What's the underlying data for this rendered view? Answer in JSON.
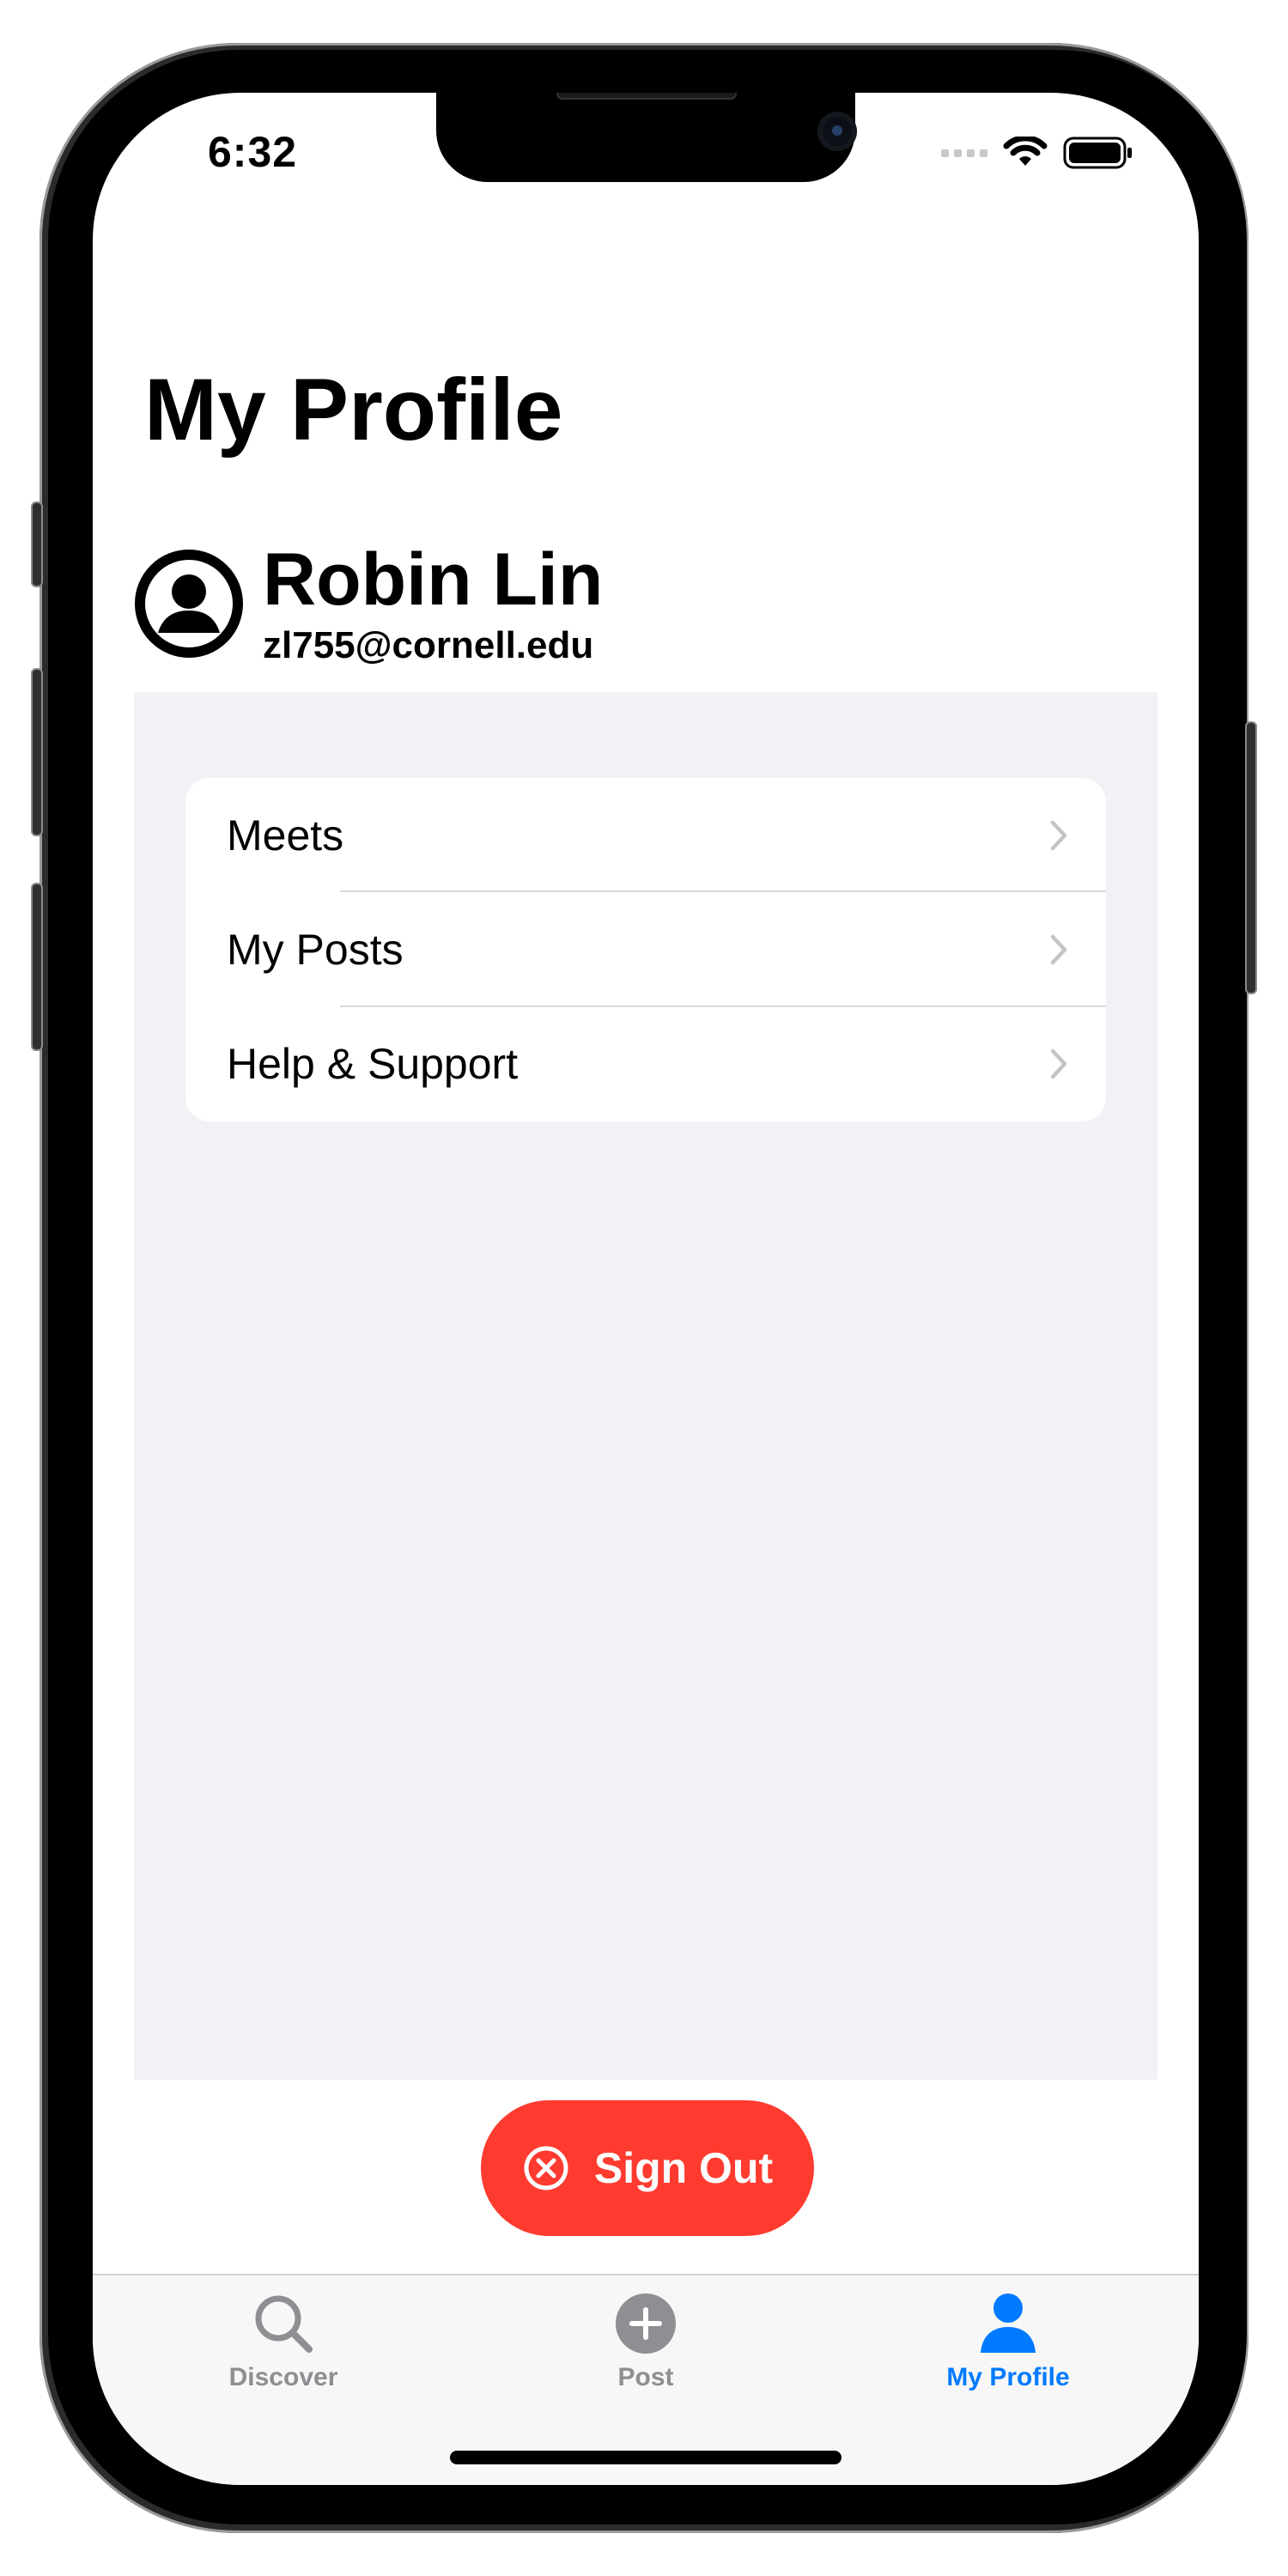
{
  "status_bar": {
    "time": "6:32"
  },
  "header": {
    "title": "My Profile"
  },
  "profile": {
    "name": "Robin Lin",
    "email": "zl755@cornell.edu"
  },
  "menu": {
    "items": [
      {
        "label": "Meets"
      },
      {
        "label": "My Posts"
      },
      {
        "label": "Help & Support"
      }
    ]
  },
  "sign_out": {
    "label": "Sign Out"
  },
  "tab_bar": {
    "tabs": [
      {
        "label": "Discover",
        "icon": "search-icon",
        "selected": false
      },
      {
        "label": "Post",
        "icon": "plus-circle-icon",
        "selected": false
      },
      {
        "label": "My Profile",
        "icon": "person-icon",
        "selected": true
      }
    ]
  },
  "colors": {
    "accent": "#007aff",
    "destructive": "#ff3b30",
    "inactive_tab": "#8e8e93",
    "grouped_background": "#f1f1f6"
  }
}
